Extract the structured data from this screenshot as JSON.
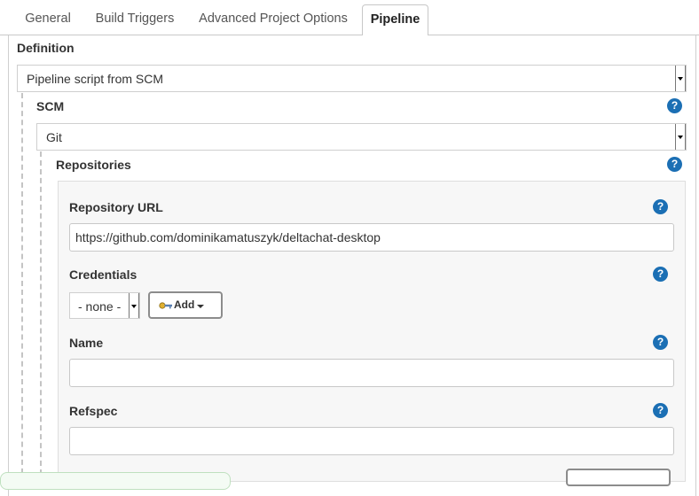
{
  "tabs": [
    {
      "label": "General",
      "active": false
    },
    {
      "label": "Build Triggers",
      "active": false
    },
    {
      "label": "Advanced Project Options",
      "active": false
    },
    {
      "label": "Pipeline",
      "active": true
    }
  ],
  "definition": {
    "label": "Definition",
    "selected": "Pipeline script from SCM"
  },
  "scm": {
    "label": "SCM",
    "selected": "Git"
  },
  "repositories": {
    "label": "Repositories",
    "repository_url": {
      "label": "Repository URL",
      "value": "https://github.com/dominikamatuszyk/deltachat-desktop"
    },
    "credentials": {
      "label": "Credentials",
      "selected": "- none -",
      "add_label": "Add"
    },
    "name": {
      "label": "Name",
      "value": ""
    },
    "refspec": {
      "label": "Refspec",
      "value": ""
    }
  },
  "help_glyph": "?",
  "colors": {
    "help_icon": "#1b6fb4",
    "border": "#cfcfcf",
    "repo_box_bg": "#f7f7f7"
  },
  "icons": [
    "help-icon",
    "key-icon",
    "caret-down-icon"
  ]
}
